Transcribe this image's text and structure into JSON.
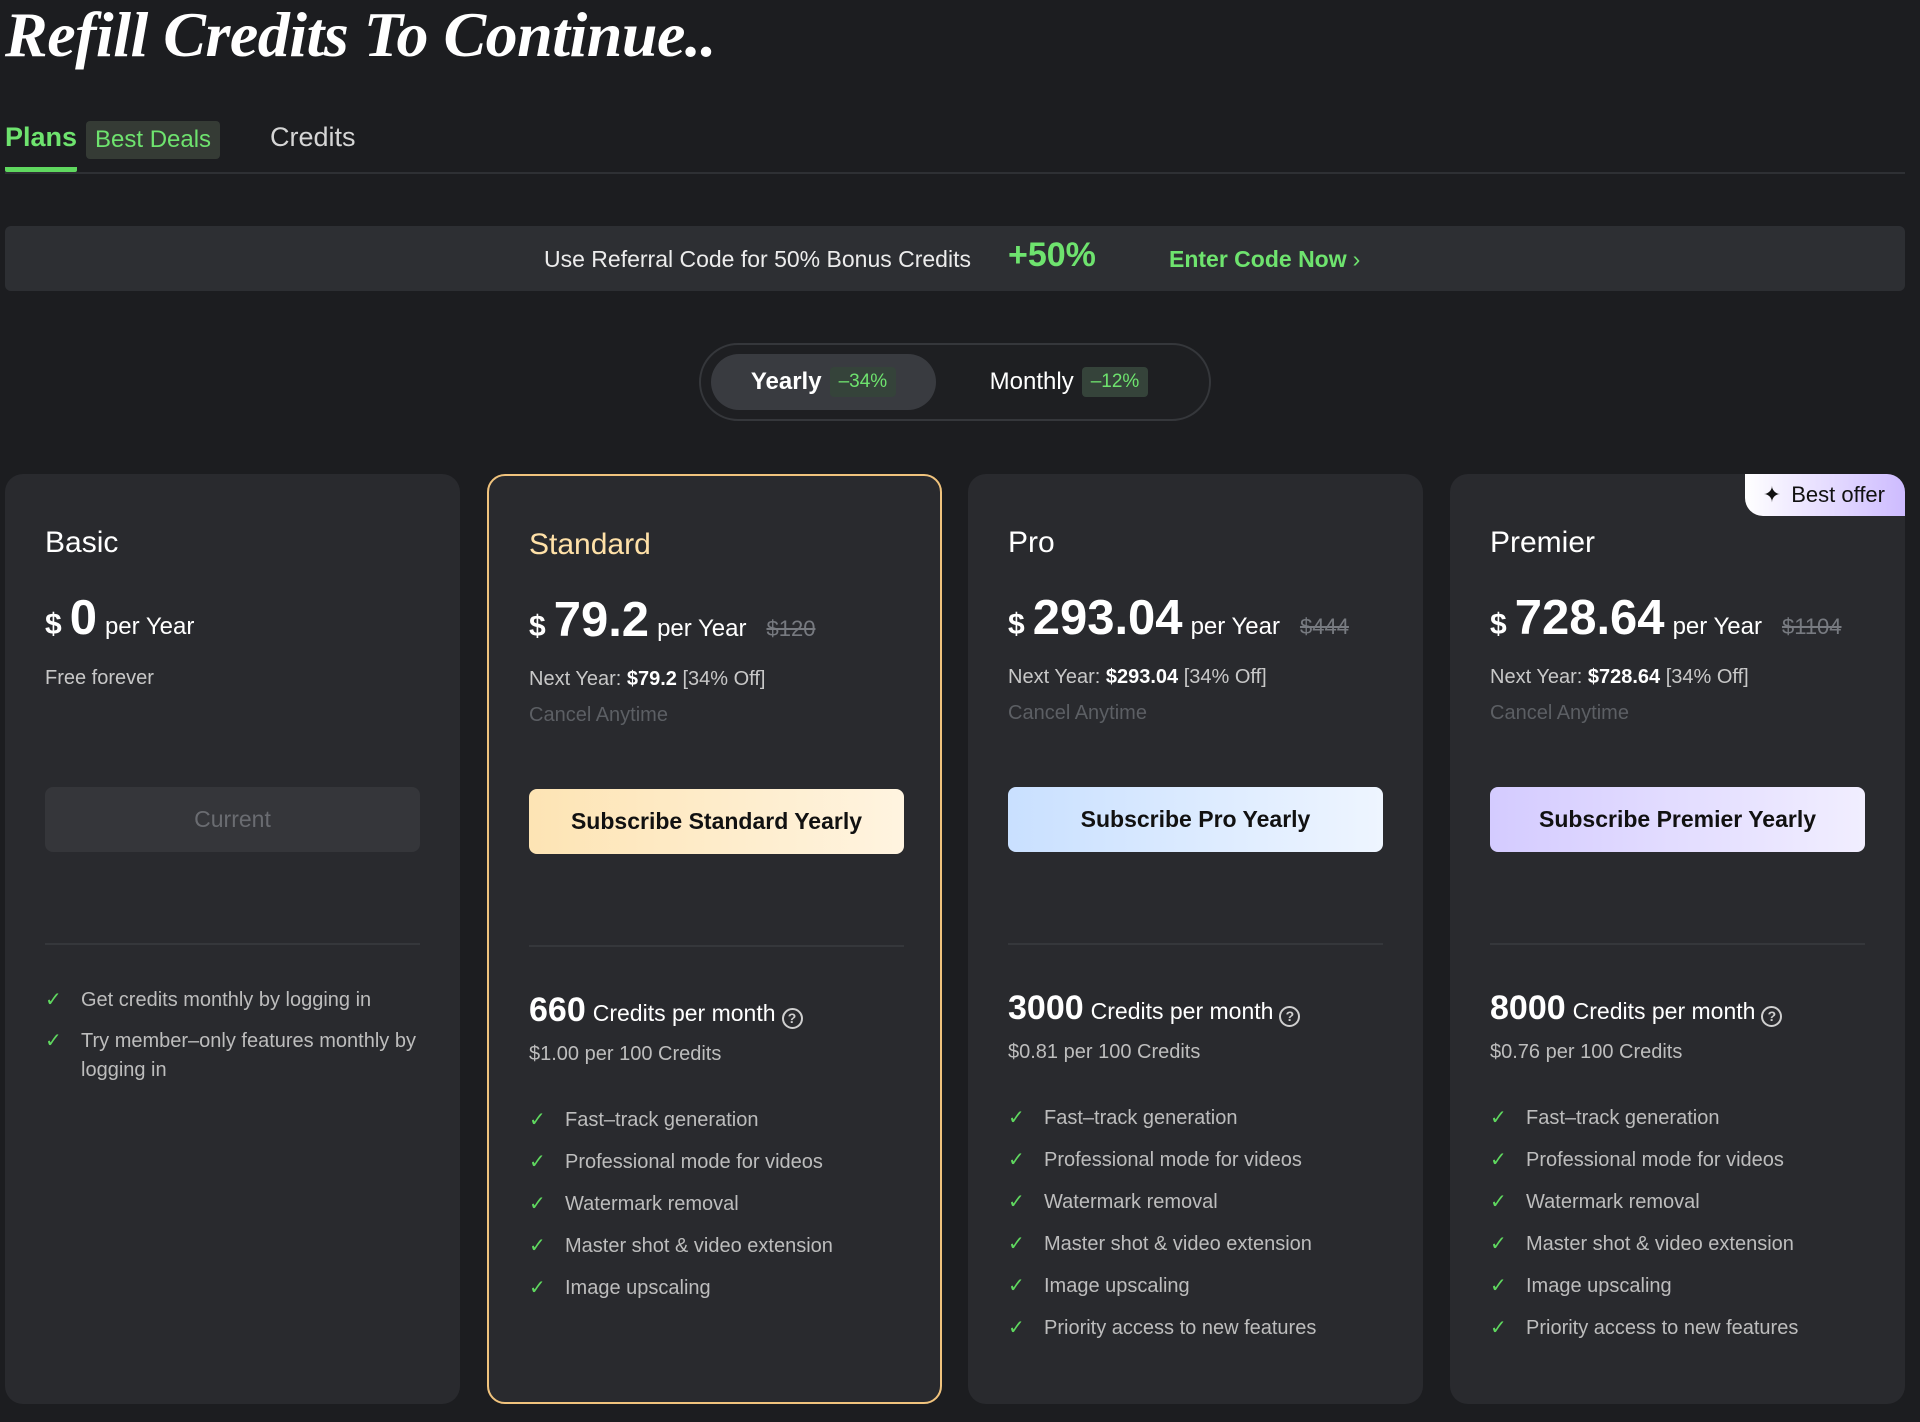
{
  "title": "Refill Credits To Continue..",
  "tabs": {
    "plans": "Plans",
    "plans_badge": "Best Deals",
    "credits": "Credits"
  },
  "banner": {
    "text": "Use Referral Code for 50% Bonus Credits",
    "pct": "+50%",
    "link": "Enter Code Now",
    "link_chevron": "›"
  },
  "billing": {
    "yearly": "Yearly",
    "yearly_badge": "–34%",
    "monthly": "Monthly",
    "monthly_badge": "–12%"
  },
  "currency": "$",
  "per": "per Year",
  "next_year_label": "Next Year:",
  "cancel": "Cancel Anytime",
  "credits_label": "Credits per month",
  "best_offer": "Best offer",
  "plans": [
    {
      "name": "Basic",
      "amount": "0",
      "free_text": "Free forever",
      "cta": "Current",
      "features": [
        "Get credits monthly by logging in",
        "Try member–only features monthly by logging in"
      ]
    },
    {
      "name": "Standard",
      "amount": "79.2",
      "orig": "$120",
      "next_price": "$79.2",
      "next_off": "[34% Off]",
      "cta": "Subscribe Standard Yearly",
      "credits": "660",
      "rate": "$1.00 per 100 Credits",
      "features": [
        "Fast–track generation",
        "Professional mode for videos",
        "Watermark removal",
        "Master shot & video extension",
        "Image upscaling"
      ]
    },
    {
      "name": "Pro",
      "amount": "293.04",
      "orig": "$444",
      "next_price": "$293.04",
      "next_off": "[34% Off]",
      "cta": "Subscribe Pro Yearly",
      "credits": "3000",
      "rate": "$0.81 per 100 Credits",
      "features": [
        "Fast–track generation",
        "Professional mode for videos",
        "Watermark removal",
        "Master shot & video extension",
        "Image upscaling",
        "Priority access to new features"
      ]
    },
    {
      "name": "Premier",
      "amount": "728.64",
      "orig": "$1104",
      "next_price": "$728.64",
      "next_off": "[34% Off]",
      "cta": "Subscribe Premier Yearly",
      "credits": "8000",
      "rate": "$0.76 per 100 Credits",
      "features": [
        "Fast–track generation",
        "Professional mode for videos",
        "Watermark removal",
        "Master shot & video extension",
        "Image upscaling",
        "Priority access to new features"
      ]
    }
  ],
  "colors": {
    "accent_green": "#6ee36e",
    "standard_border": "#f0c37d"
  }
}
